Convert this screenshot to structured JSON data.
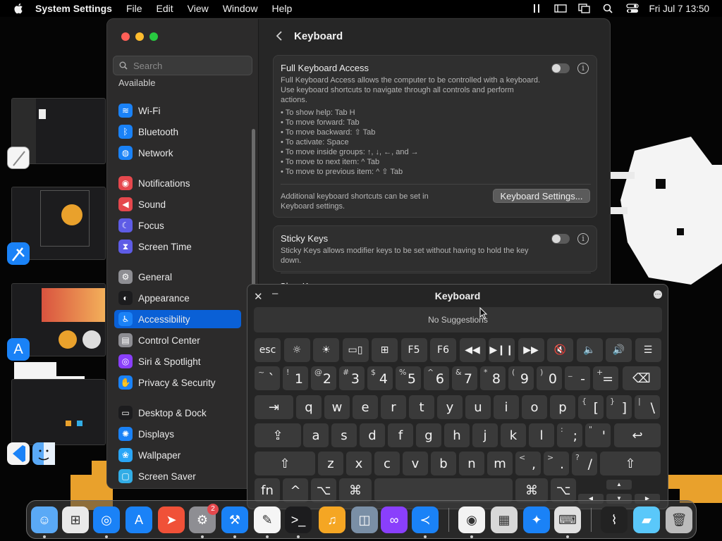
{
  "menubar": {
    "apple": "apple-logo",
    "app_name": "System Settings",
    "menus": [
      "File",
      "Edit",
      "View",
      "Window",
      "Help"
    ],
    "clock": "Fri Jul 7  13:50"
  },
  "settings": {
    "search_placeholder": "Search",
    "sidebar_cut": "Available",
    "sidebar": [
      {
        "label": "Wi-Fi",
        "icon": "wifi-icon",
        "color": "#1a82f7",
        "glyph": "≋"
      },
      {
        "label": "Bluetooth",
        "icon": "bluetooth-icon",
        "color": "#1a82f7",
        "glyph": "ᛒ"
      },
      {
        "label": "Network",
        "icon": "network-icon",
        "color": "#1a82f7",
        "glyph": "◍"
      },
      {
        "label": "Notifications",
        "icon": "notifications-icon",
        "color": "#e5484d",
        "glyph": "◉"
      },
      {
        "label": "Sound",
        "icon": "sound-icon",
        "color": "#e5484d",
        "glyph": "◀"
      },
      {
        "label": "Focus",
        "icon": "focus-icon",
        "color": "#5e5ce6",
        "glyph": "☾"
      },
      {
        "label": "Screen Time",
        "icon": "screen-time-icon",
        "color": "#5e5ce6",
        "glyph": "⧗"
      },
      {
        "label": "General",
        "icon": "general-icon",
        "color": "#8e8e93",
        "glyph": "⚙"
      },
      {
        "label": "Appearance",
        "icon": "appearance-icon",
        "color": "#1c1c1e",
        "glyph": "◐"
      },
      {
        "label": "Accessibility",
        "icon": "accessibility-icon",
        "color": "#1a82f7",
        "glyph": "♿"
      },
      {
        "label": "Control Center",
        "icon": "control-center-icon",
        "color": "#8e8e93",
        "glyph": "▤"
      },
      {
        "label": "Siri & Spotlight",
        "icon": "siri-icon",
        "color": "#8a3ffc",
        "glyph": "◎"
      },
      {
        "label": "Privacy & Security",
        "icon": "privacy-icon",
        "color": "#1a82f7",
        "glyph": "✋"
      },
      {
        "label": "Desktop & Dock",
        "icon": "desktop-dock-icon",
        "color": "#1c1c1e",
        "glyph": "▭"
      },
      {
        "label": "Displays",
        "icon": "displays-icon",
        "color": "#1a82f7",
        "glyph": "✺"
      },
      {
        "label": "Wallpaper",
        "icon": "wallpaper-icon",
        "color": "#2aa6f7",
        "glyph": "❀"
      },
      {
        "label": "Screen Saver",
        "icon": "screen-saver-icon",
        "color": "#32ade6",
        "glyph": "▢"
      }
    ],
    "active_item": "Accessibility",
    "page_title": "Keyboard",
    "full_keyboard_access": {
      "title": "Full Keyboard Access",
      "enabled": false,
      "description": "Full Keyboard Access allows the computer to be controlled with a keyboard. Use keyboard shortcuts to navigate through all controls and perform actions.",
      "bullets": [
        "• To show help: Tab H",
        "• To move forward: Tab",
        "• To move backward: ⇧ Tab",
        "• To activate: Space",
        "• To move inside groups: ↑, ↓, ←, and →",
        "• To move to next item: ^ Tab",
        "• To move to previous item: ^ ⇧ Tab"
      ],
      "footer": "Additional keyboard shortcuts can be set in Keyboard settings.",
      "button": "Keyboard Settings..."
    },
    "sticky_keys": {
      "title": "Sticky Keys",
      "enabled": false,
      "description": "Sticky Keys allows modifier keys to be set without having to hold the key down."
    },
    "slow_keys_cut": "Slow Keys"
  },
  "keyboard_viewer": {
    "title": "Keyboard",
    "suggestions": "No Suggestions",
    "fn_row": [
      "esc",
      "☼",
      "☀",
      "▭▯",
      "⊞",
      "F5",
      "F6",
      "◀◀",
      "▶❙❙",
      "▶▶",
      "🔇",
      "🔈",
      "🔊",
      "☰"
    ],
    "row1": [
      [
        "~",
        "`"
      ],
      [
        "!",
        "1"
      ],
      [
        "@",
        "2"
      ],
      [
        "#",
        "3"
      ],
      [
        "$",
        "4"
      ],
      [
        "%",
        "5"
      ],
      [
        "^",
        "6"
      ],
      [
        "&",
        "7"
      ],
      [
        "*",
        "8"
      ],
      [
        "(",
        "9"
      ],
      [
        ")",
        "0"
      ],
      [
        "_",
        "-"
      ],
      [
        "+",
        "="
      ]
    ],
    "row2": [
      "q",
      "w",
      "e",
      "r",
      "t",
      "y",
      "u",
      "i",
      "o",
      "p"
    ],
    "row2_brackets": [
      [
        "{",
        "["
      ],
      [
        "}",
        "]"
      ],
      [
        "|",
        "\\"
      ]
    ],
    "row3": [
      "a",
      "s",
      "d",
      "f",
      "g",
      "h",
      "j",
      "k",
      "l"
    ],
    "row3_punct": [
      [
        ":",
        ";"
      ],
      [
        "\"",
        "'"
      ]
    ],
    "row4": [
      "z",
      "x",
      "c",
      "v",
      "b",
      "n",
      "m"
    ],
    "row4_punct": [
      [
        "<",
        ","
      ],
      [
        ">",
        "."
      ],
      [
        "?",
        "/"
      ]
    ],
    "mods": {
      "tab": "⇥",
      "delete": "⌫",
      "caps": "⇪",
      "return": "↩",
      "shift": "⇧",
      "fn": "fn",
      "ctrl": "^",
      "option": "⌥",
      "command": "⌘"
    }
  },
  "dock": {
    "badge_settings": "2",
    "apps": [
      "finder-icon",
      "launchpad-icon",
      "safari-icon",
      "app-store-icon",
      "swift-icon",
      "system-settings-icon",
      "xcode-icon",
      "textedit-icon",
      "terminal-icon",
      "garageband-icon",
      "preview-icon",
      "visual-studio-icon",
      "vscode-icon",
      "chrome-icon",
      "scanner-icon",
      "xcode-instruments-icon",
      "keyboard-viewer-icon",
      "activity-monitor-icon",
      "downloads-folder-icon",
      "trash-icon"
    ]
  },
  "colors": {
    "accent": "#0a60d6",
    "window_bg": "#262626",
    "sidebar_bg": "#2c2b2b"
  }
}
